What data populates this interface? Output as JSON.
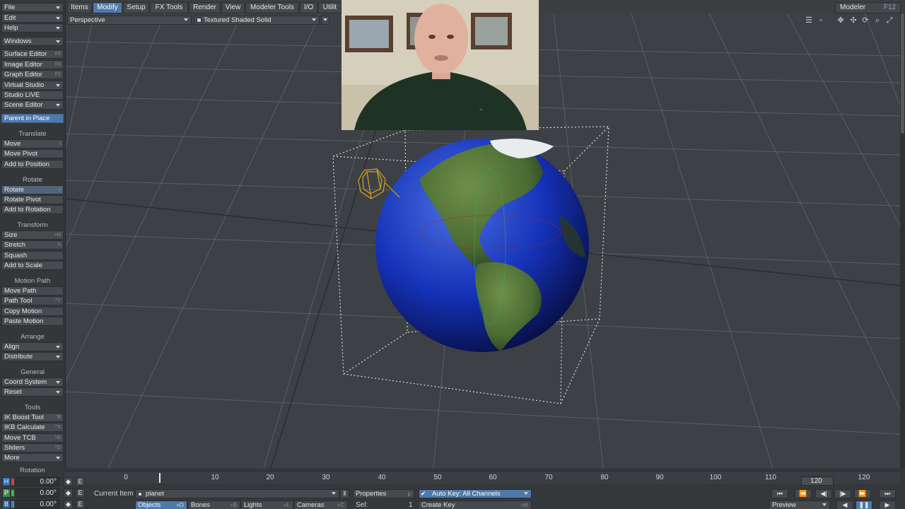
{
  "left_panel": {
    "menus": [
      {
        "label": "File"
      },
      {
        "label": "Edit"
      },
      {
        "label": "Help"
      },
      {
        "label": "Windows"
      }
    ],
    "editors": [
      {
        "label": "Surface Editor",
        "shortcut": "F5"
      },
      {
        "label": "Image Editor",
        "shortcut": "F6"
      },
      {
        "label": "Graph Editor",
        "shortcut": "F2"
      },
      {
        "label": "Virtual Studio",
        "shortcut": ""
      },
      {
        "label": "Studio LIVE",
        "shortcut": ""
      },
      {
        "label": "Scene Editor",
        "shortcut": ""
      }
    ],
    "parent_in_place": "Parent in Place",
    "sections": {
      "translate": "Translate",
      "rotate": "Rotate",
      "transform": "Transform",
      "motion_path": "Motion Path",
      "arrange": "Arrange",
      "general": "General",
      "tools": "Tools",
      "rotation": "Rotation"
    },
    "translate_items": [
      {
        "label": "Move",
        "shortcut": "t"
      },
      {
        "label": "Move Pivot",
        "shortcut": ""
      },
      {
        "label": "Add to Position",
        "shortcut": ""
      }
    ],
    "rotate_items": [
      {
        "label": "Rotate",
        "shortcut": "y"
      },
      {
        "label": "Rotate Pivot",
        "shortcut": ""
      },
      {
        "label": "Add to Rotation",
        "shortcut": ""
      }
    ],
    "transform_items": [
      {
        "label": "Size",
        "shortcut": "+H"
      },
      {
        "label": "Stretch",
        "shortcut": "h"
      },
      {
        "label": "Squash",
        "shortcut": ""
      },
      {
        "label": "Add to Scale",
        "shortcut": ""
      }
    ],
    "motion_items": [
      {
        "label": "Move Path",
        "shortcut": ""
      },
      {
        "label": "Path Tool",
        "shortcut": "^Y"
      },
      {
        "label": "Copy Motion",
        "shortcut": ""
      },
      {
        "label": "Paste Motion",
        "shortcut": ""
      }
    ],
    "arrange_items": [
      {
        "label": "Align"
      },
      {
        "label": "Distribute"
      }
    ],
    "general_items": [
      {
        "label": "Coord System"
      },
      {
        "label": "Reset"
      }
    ],
    "tools_items": [
      {
        "label": "IK Boost Tool",
        "shortcut": "^B"
      },
      {
        "label": "IKB Calculate",
        "shortcut": "^X"
      },
      {
        "label": "Move TCB",
        "shortcut": "^G"
      },
      {
        "label": "Sliders",
        "shortcut": "^D"
      },
      {
        "label": "More",
        "shortcut": ""
      }
    ]
  },
  "menubar": {
    "tabs": [
      "Items",
      "Modify",
      "Setup",
      "FX Tools",
      "Render",
      "View",
      "Modeler Tools",
      "I/O",
      "Utilit"
    ],
    "active_tab": "Modify",
    "modeler_label": "Modeler",
    "modeler_shortcut": "F12"
  },
  "viewport": {
    "view_mode": "Perspective",
    "shading_mode": "Textured Shaded Solid"
  },
  "timeline": {
    "ticks": [
      "0",
      "10",
      "20",
      "30",
      "40",
      "50",
      "60",
      "70",
      "80",
      "90",
      "100",
      "110",
      "120"
    ],
    "end_frame_field": "120",
    "end_frame_label": "120",
    "channels": [
      {
        "key": "H",
        "value": "0.00°",
        "color": "#c8474a"
      },
      {
        "key": "P",
        "value": "0.00°",
        "color": "#4caf50"
      },
      {
        "key": "B",
        "value": "0.00°",
        "color": "#4a86c8"
      }
    ],
    "e_label": "E",
    "current_item_label": "Current Item",
    "current_item_value": "planet",
    "properties_label": "Properties",
    "properties_shortcut": "p",
    "auto_key_label": "Auto Key: All Channels",
    "create_key_label": "Create Key",
    "create_key_shortcut": "ret",
    "filters": [
      {
        "label": "Objects",
        "shortcut": "+O"
      },
      {
        "label": "Bones",
        "shortcut": "+B"
      },
      {
        "label": "Lights",
        "shortcut": "+L"
      },
      {
        "label": "Cameras",
        "shortcut": "+C"
      }
    ],
    "sel_label": "Sel:",
    "sel_value": "1",
    "preview_label": "Preview"
  },
  "colors": {
    "accent": "#4f79a8",
    "grid_line": "#5c6166",
    "bounding_box": "#e8e8e8",
    "camera": "#d9a21f"
  }
}
